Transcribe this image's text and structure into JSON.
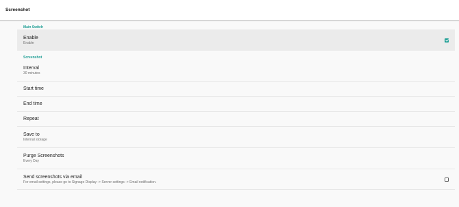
{
  "app_bar": {
    "title": "Screenshot"
  },
  "sections": {
    "main_switch": "Main Switch",
    "screenshot": "Screenshot"
  },
  "rows": {
    "enable": {
      "title": "Enable",
      "subtitle": "Enable",
      "checked": true
    },
    "interval": {
      "title": "Interval",
      "subtitle": "30 minutes"
    },
    "start_time": {
      "title": "Start time"
    },
    "end_time": {
      "title": "End time"
    },
    "repeat": {
      "title": "Repeat"
    },
    "save_to": {
      "title": "Save to",
      "subtitle": "Internal storage"
    },
    "purge": {
      "title": "Purge Screenshots",
      "subtitle": "Every Day"
    },
    "email": {
      "title": "Send screenshots via email",
      "subtitle": "For email settings, please go to Signage Display -> Server settings -> Email notification.",
      "checked": false
    }
  },
  "colors": {
    "accent": "#1e9e94",
    "highlight": "#ebebeb",
    "background": "#f9f9f9"
  }
}
